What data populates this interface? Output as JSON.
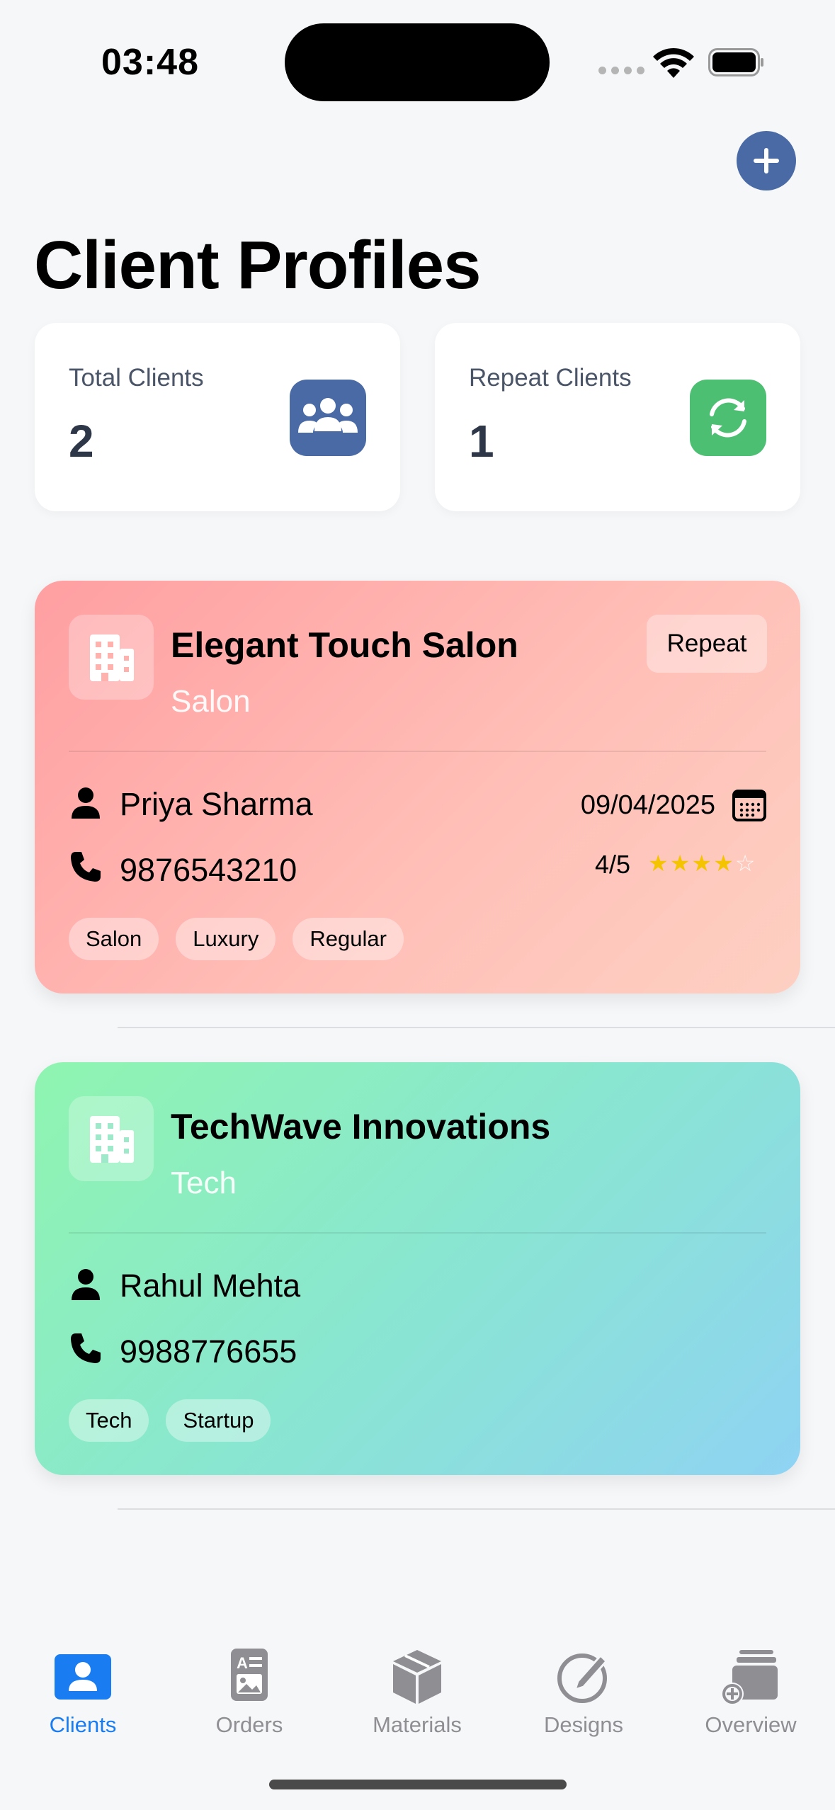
{
  "status_bar": {
    "time": "03:48"
  },
  "page": {
    "title": "Client Profiles"
  },
  "stats": [
    {
      "label": "Total Clients",
      "value": "2",
      "icon": "users-icon",
      "color": "#4a6aa5"
    },
    {
      "label": "Repeat Clients",
      "value": "1",
      "icon": "refresh-icon",
      "color": "#4cbf73"
    }
  ],
  "clients": [
    {
      "name": "Elegant Touch Salon",
      "category": "Salon",
      "badge": "Repeat",
      "contact": "Priya Sharma",
      "phone": "9876543210",
      "date": "09/04/2025",
      "rating_text": "4/5",
      "rating": 4,
      "rating_max": 5,
      "tags": [
        "Salon",
        "Luxury",
        "Regular"
      ]
    },
    {
      "name": "TechWave Innovations",
      "category": "Tech",
      "contact": "Rahul Mehta",
      "phone": "9988776655",
      "tags": [
        "Tech",
        "Startup"
      ]
    }
  ],
  "tabs": [
    {
      "label": "Clients",
      "icon": "person-card-icon",
      "active": true
    },
    {
      "label": "Orders",
      "icon": "document-icon",
      "active": false
    },
    {
      "label": "Materials",
      "icon": "box-icon",
      "active": false
    },
    {
      "label": "Designs",
      "icon": "pencil-circle-icon",
      "active": false
    },
    {
      "label": "Overview",
      "icon": "stack-plus-icon",
      "active": false
    }
  ],
  "colors": {
    "accent": "#1a7cf1",
    "add_button": "#4a6aa5",
    "background": "#f6f7f9",
    "star": "#f5c400"
  }
}
